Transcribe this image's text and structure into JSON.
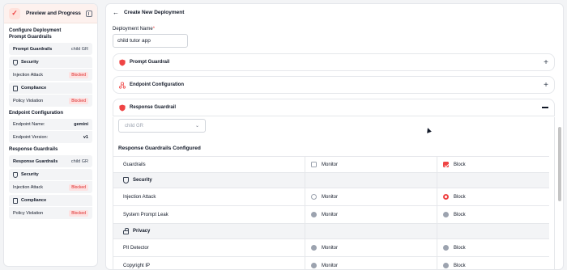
{
  "sidebar": {
    "title": "Preview and Progress",
    "configure_title": "Configure Deployment",
    "prompt_guardrails": {
      "title": "Prompt Guardrails",
      "row_label": "Prompt Guardrails",
      "row_value": "child GR",
      "security_label": "Security",
      "injection_label": "Injection Attack",
      "injection_status": "Blocked",
      "compliance_label": "Compliance",
      "policy_label": "Policy Violation",
      "policy_status": "Blocked"
    },
    "endpoint": {
      "title": "Endpoint Configuration",
      "name_label": "Endpoint Name:",
      "name_value": "gemini",
      "version_label": "Endpoint Version:",
      "version_value": "v1"
    },
    "response_guardrails": {
      "title": "Response Guardrails",
      "row_label": "Response Guardrails",
      "row_value": "child GR",
      "security_label": "Security",
      "injection_label": "Injection Attack",
      "injection_status": "Blocked",
      "compliance_label": "Compliance",
      "policy_label": "Policy Violation",
      "policy_status": "Blocked"
    }
  },
  "main": {
    "title": "Create New Deployment",
    "name_label": "Deployment Name",
    "name_required": "*",
    "name_value": "child tutor app",
    "accordions": {
      "prompt": "Prompt Guardrail",
      "endpoint": "Endpoint Configuration",
      "response": "Response Guardrail"
    },
    "select_value": "child GR",
    "configured_title": "Response Guardrails Configured",
    "table": {
      "header": {
        "name": "Guardrails",
        "monitor": "Monitor",
        "block": "Block"
      },
      "security_section": "Security",
      "injection": {
        "name": "Injection Attack",
        "monitor": "Monitor",
        "block": "Block"
      },
      "system_prompt": {
        "name": "System Prompt Leak",
        "monitor": "Monitor",
        "block": "Block"
      },
      "privacy_section": "Privacy",
      "pii": {
        "name": "PII Detector",
        "monitor": "Monitor",
        "block": "Block"
      },
      "copyright": {
        "name": "Copyright IP",
        "monitor": "Monitor",
        "block": "Block"
      }
    }
  },
  "colors": {
    "accent": "#ef4444",
    "blocked_bg": "#fde2e2",
    "sidebar_header_bg": "#fdf1ee"
  }
}
